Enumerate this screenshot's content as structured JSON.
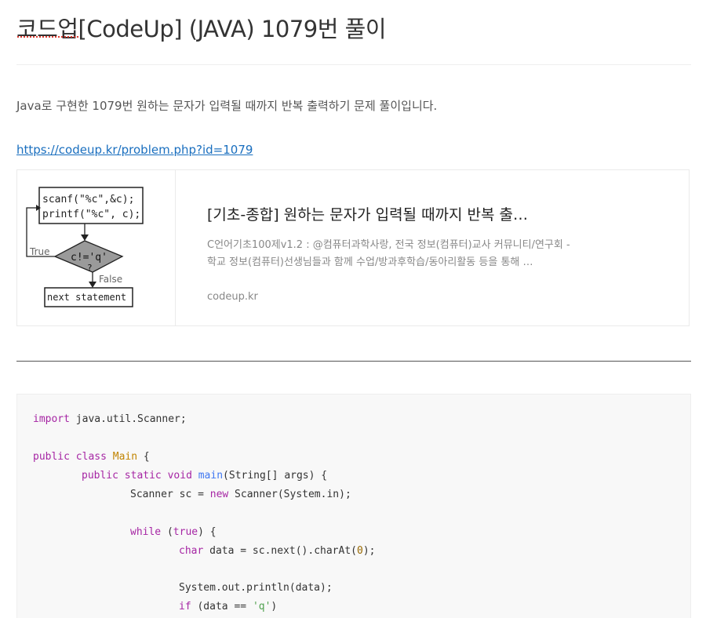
{
  "post": {
    "title": "코드업[CodeUp] (JAVA) 1079번 풀이",
    "intro": "Java로 구현한 1079번 원하는 문자가 입력될 때까지 반복 출력하기 문제 풀이입니다.",
    "link": "https://codeup.kr/problem.php?id=1079"
  },
  "card": {
    "title": "[기초-종합] 원하는 문자가 입력될 때까지 반복 출…",
    "description": "C언어기초100제v1.2 : @컴퓨터과학사랑, 전국 정보(컴퓨터)교사 커뮤니티/연구회 - 학교 정보(컴퓨터)선생님들과 함께 수업/방과후학습/동아리활동 등을 통해 …",
    "domain": "codeup.kr",
    "thumbnail": {
      "line1": "scanf(\"%c\",&c);",
      "line2": "printf(\"%c\", c);",
      "true_label": "True",
      "condition": "c!='q'",
      "question": "?",
      "false_label": "False",
      "next": "next statement"
    }
  },
  "code": {
    "import_kw": "import",
    "import_rest": " java.util.Scanner;",
    "public1": "public",
    "class_kw": "class",
    "class_name": "Main",
    "brace_open": " {",
    "public2": "public",
    "static_kw": "static",
    "void_kw": "void",
    "main_fn": "main",
    "main_args": "(String[] args) {",
    "scanner_pre": "Scanner sc = ",
    "new_kw": "new",
    "scanner_post": " Scanner(System.in);",
    "while_kw": "while",
    "paren_open": " (",
    "true_kw": "true",
    "paren_close": ") {",
    "char_kw": "char",
    "char_pre": " data = sc.next().charAt(",
    "zero": "0",
    "char_post": ");",
    "println": "System.out.println(data);",
    "if_kw": "if",
    "if_pre": " (data == ",
    "q_str": "'q'",
    "if_post": ")"
  },
  "colors": {
    "keyword": "#a626a4",
    "class_name": "#c18401",
    "function": "#4078f2",
    "number": "#986801",
    "string": "#50a14f",
    "link": "#1a6fbf"
  }
}
